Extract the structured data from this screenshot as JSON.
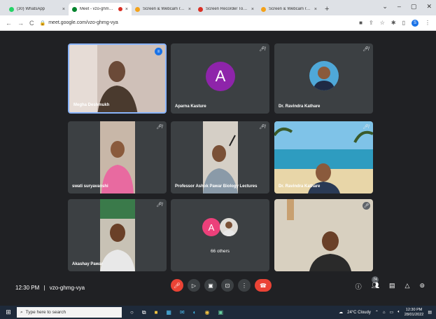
{
  "browser": {
    "tabs": [
      {
        "title": "(30) WhatsApp",
        "color": "#25d366"
      },
      {
        "title": "Meet - vzo-ghmg-vya",
        "color": "#00832d",
        "active": true
      },
      {
        "title": "Screen & Webcam recorder",
        "color": "#f4a21a"
      },
      {
        "title": "Screen Recorder Tool | Reco",
        "color": "#d93025"
      },
      {
        "title": "Screen & Webcam recorder",
        "color": "#f4a21a"
      }
    ],
    "url": "meet.google.com/vzo-ghmg-vya",
    "profile_initial": "S"
  },
  "participants": [
    {
      "name": "Megha Deshmukh",
      "type": "video",
      "speaking": true
    },
    {
      "name": "Aparna Kasture",
      "type": "avatar",
      "initial": "A",
      "color": "#8e24aa"
    },
    {
      "name": "Dr. Ravindra Kathare",
      "type": "photo"
    },
    {
      "name": "swati suryavanshi",
      "type": "video"
    },
    {
      "name": "Professor Ashok Pawar Biology Lectures",
      "type": "video"
    },
    {
      "name": "Dr. Ravindra Kathare",
      "type": "video"
    },
    {
      "name": "Akashay Pawar",
      "type": "video"
    },
    {
      "name": "66 others",
      "type": "others",
      "initial": "A"
    },
    {
      "name": "",
      "type": "video"
    }
  ],
  "meeting": {
    "time": "12:30 PM",
    "separator": "|",
    "code": "vzo-ghmg-vya",
    "participant_count": "74"
  },
  "taskbar": {
    "search_placeholder": "Type here to search",
    "weather": "24°C  Cloudy",
    "time": "12:30 PM",
    "date": "28/01/2022"
  }
}
